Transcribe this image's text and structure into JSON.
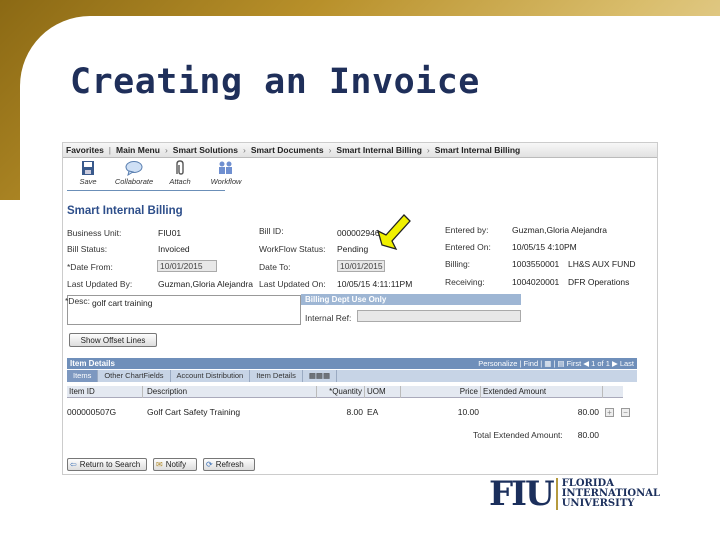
{
  "slide": {
    "title": "Creating an Invoice",
    "colors": {
      "gold": "#b8902a",
      "navy": "#1f2f5a",
      "arrow": "#f0f000"
    }
  },
  "breadcrumb": [
    "Favorites",
    "Main Menu",
    "Smart Solutions",
    "Smart Documents",
    "Smart Internal Billing",
    "Smart Internal Billing"
  ],
  "toolbar": {
    "save": "Save",
    "collaborate": "Collaborate",
    "attach": "Attach",
    "workflow": "Workflow"
  },
  "page": {
    "title": "Smart Internal Billing",
    "business_unit_label": "Business Unit:",
    "business_unit": "FIU01",
    "bill_id_label": "Bill ID:",
    "bill_id": "000002946",
    "entered_by_label": "Entered by:",
    "entered_by": "Guzman,Gloria Alejandra",
    "bill_status_label": "Bill Status:",
    "bill_status": "Invoiced",
    "workflow_status_label": "WorkFlow Status:",
    "workflow_status": "Pending",
    "entered_on_label": "Entered On:",
    "entered_on": "10/05/15 4:10PM",
    "date_from_label": "*Date From:",
    "date_from": "10/01/2015",
    "date_to_label": "Date To:",
    "date_to": "10/01/2015",
    "billing_label": "Billing:",
    "billing_code": "1003550001",
    "billing_name": "LH&S AUX FUND",
    "last_updated_by_label": "Last Updated By:",
    "last_updated_by": "Guzman,Gloria Alejandra",
    "last_updated_on_label": "Last Updated On:",
    "last_updated_on": "10/05/15 4:11:11PM",
    "receiving_label": "Receiving:",
    "receiving_code": "1004020001",
    "receiving_name": "DFR Operations",
    "desc_label": "*Desc:",
    "desc": "golf cart training",
    "billing_dept_header": "Billing Dept Use Only",
    "internal_ref_label": "Internal Ref:",
    "show_offset_button": "Show Offset Lines"
  },
  "grid": {
    "title": "Item Details",
    "nav": "Personalize | Find | ▦ | ▤    First ◀ 1 of 1 ▶ Last",
    "tabs": [
      "Items",
      "Other ChartFields",
      "Account Distribution",
      "Item Details",
      "▦▦▦"
    ],
    "columns": [
      "Item ID",
      "Description",
      "*Quantity",
      "UOM",
      "Price",
      "Extended Amount"
    ],
    "rows": [
      {
        "item_id": "000000507G",
        "description": "Golf Cart Safety Training",
        "quantity": "8.00",
        "uom": "EA",
        "price": "10.00",
        "extended": "80.00"
      }
    ],
    "total_label": "Total Extended Amount:",
    "total": "80.00"
  },
  "footer_buttons": {
    "return": "Return to Search",
    "notify": "Notify",
    "refresh": "Refresh"
  },
  "logo": {
    "mark": "FIU",
    "line1": "FLORIDA",
    "line2": "INTERNATIONAL",
    "line3": "UNIVERSITY"
  }
}
